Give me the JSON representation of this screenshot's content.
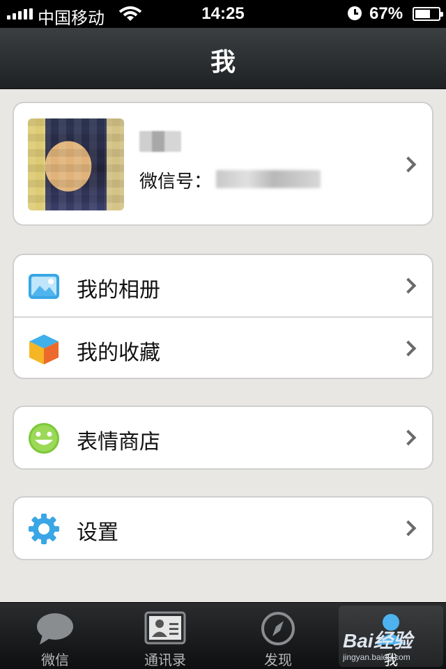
{
  "status_bar": {
    "carrier": "中国移动",
    "time": "14:25",
    "battery": "67%",
    "battery_level": 0.67,
    "icons": [
      "signal-icon",
      "wifi-icon",
      "alarm-icon",
      "battery-icon"
    ]
  },
  "header": {
    "title": "我"
  },
  "profile": {
    "wechat_id_label": "微信号："
  },
  "menu": {
    "album": {
      "label": "我的相册",
      "icon": "photo-album-icon"
    },
    "favorites": {
      "label": "我的收藏",
      "icon": "favorites-box-icon"
    },
    "sticker_store": {
      "label": "表情商店",
      "icon": "smiley-icon"
    },
    "settings": {
      "label": "设置",
      "icon": "gear-icon"
    }
  },
  "tabs": [
    {
      "label": "微信",
      "icon": "chat-bubble-icon"
    },
    {
      "label": "通讯录",
      "icon": "contacts-card-icon"
    },
    {
      "label": "发现",
      "icon": "compass-icon"
    },
    {
      "label": "我",
      "icon": "person-icon",
      "active": true
    }
  ],
  "watermark": {
    "main": "Bai经验",
    "sub": "jingyan.baidu.com"
  },
  "colors": {
    "background": "#e8e7e4",
    "header": "#2a2d2f",
    "card": "#ffffff",
    "chevron": "#6a6a6a",
    "tab_bar": "#1c1e20"
  }
}
